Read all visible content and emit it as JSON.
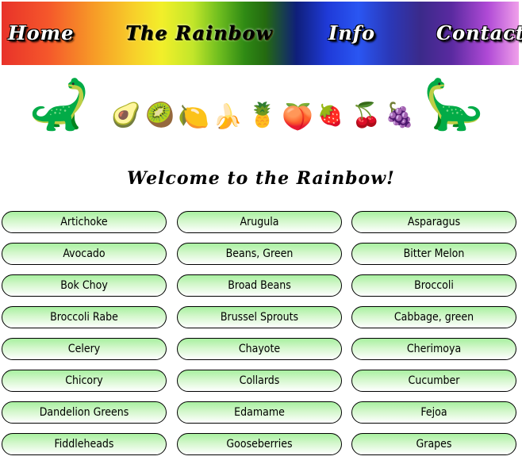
{
  "nav": {
    "home": "Home",
    "title": "The Rainbow",
    "info": "Info",
    "contact": "Contact"
  },
  "decor": [
    {
      "name": "dinosaur-left-icon",
      "glyph": "🦕"
    },
    {
      "name": "avocado-icon",
      "glyph": "🥑"
    },
    {
      "name": "kiwi-icon",
      "glyph": "🥝"
    },
    {
      "name": "lemon-icon",
      "glyph": "🍋"
    },
    {
      "name": "banana-icon",
      "glyph": "🍌"
    },
    {
      "name": "pineapple-icon",
      "glyph": "🍍"
    },
    {
      "name": "peach-icon",
      "glyph": "🍑"
    },
    {
      "name": "strawberry-icon",
      "glyph": "🍓"
    },
    {
      "name": "cherries-icon",
      "glyph": "🍒"
    },
    {
      "name": "grapes-icon",
      "glyph": "🍇"
    },
    {
      "name": "dinosaur-right-icon",
      "glyph": "🦕"
    }
  ],
  "heading": "Welcome to the Rainbow!",
  "items": [
    "Artichoke",
    "Arugula",
    "Asparagus",
    "Avocado",
    "Beans, Green",
    "Bitter Melon",
    "Bok Choy",
    "Broad Beans",
    "Broccoli",
    "Broccoli Rabe",
    "Brussel Sprouts",
    "Cabbage, green",
    "Celery",
    "Chayote",
    "Cherimoya",
    "Chicory",
    "Collards",
    "Cucumber",
    "Dandelion Greens",
    "Edamame",
    "Fejoa",
    "Fiddleheads",
    "Gooseberries",
    "Grapes"
  ],
  "colors": {
    "pill_top": "#a8f0a0",
    "pill_bottom": "#ffffff",
    "dino_green": "#8db52a"
  }
}
